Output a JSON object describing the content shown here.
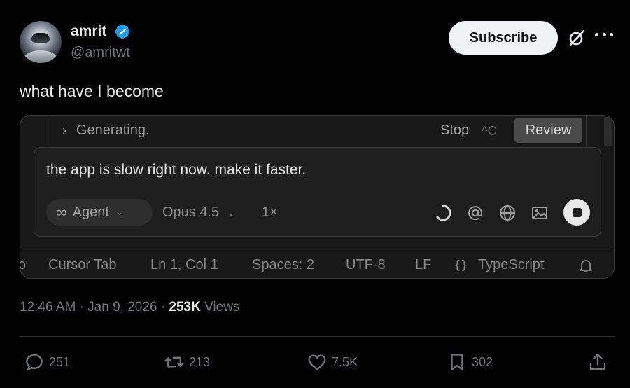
{
  "author": {
    "display_name": "amrit",
    "handle": "@amritwt",
    "verified": true
  },
  "header": {
    "subscribe_label": "Subscribe",
    "icons": [
      "grok-icon",
      "more-icon"
    ]
  },
  "tweet": {
    "text": "what have I become"
  },
  "media": {
    "generating_label": "Generating.",
    "stop_label": "Stop",
    "stop_shortcut": "^C",
    "review_label": "Review",
    "prompt_text": "the app is slow right now. make it faster.",
    "mode_icon": "∞",
    "mode_label": "Agent",
    "model_label": "Opus 4.5",
    "multiplier_label": "1×",
    "tool_icons": [
      "spinner-icon",
      "at-icon",
      "globe-icon",
      "image-icon",
      "stop-icon"
    ],
    "status_bar": {
      "cursor_tab": "Cursor Tab",
      "position": "Ln 1, Col 1",
      "spaces": "Spaces: 2",
      "encoding": "UTF-8",
      "line_ending": "LF",
      "language_icon": "{}",
      "language": "TypeScript"
    }
  },
  "meta": {
    "time": "12:46 AM",
    "separator": "·",
    "date": "Jan 9, 2026",
    "views_count": "253K",
    "views_label": "Views"
  },
  "actions": {
    "replies": "251",
    "reposts": "213",
    "likes": "7.5K",
    "bookmarks": "302"
  },
  "colors": {
    "background": "#000000",
    "verified_blue": "#1d9bf0",
    "secondary_text": "#71767b"
  }
}
